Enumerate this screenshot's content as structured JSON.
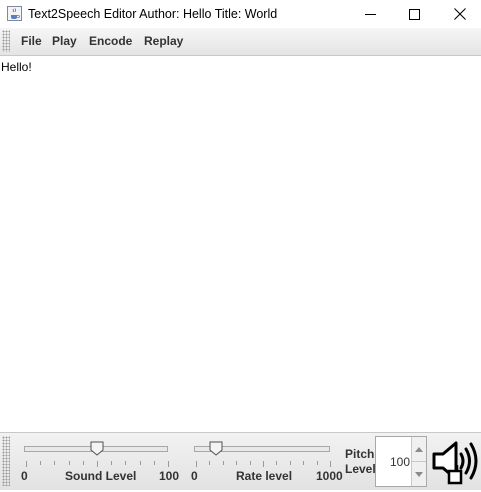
{
  "window": {
    "title": "Text2Speech Editor Author: Hello Title: World",
    "icon": "java-cup-icon"
  },
  "menu": {
    "items": [
      {
        "label": "File"
      },
      {
        "label": "Play"
      },
      {
        "label": "Encode"
      },
      {
        "label": "Replay"
      }
    ]
  },
  "editor": {
    "text": "Hello!"
  },
  "controls": {
    "sound": {
      "label": "Sound Level",
      "min_label": "0",
      "max_label": "100",
      "min": 0,
      "max": 100,
      "value": 50
    },
    "rate": {
      "label": "Rate level",
      "min_label": "0",
      "max_label": "1000",
      "min": 0,
      "max": 1000,
      "value": 150
    },
    "pitch": {
      "label_line1": "Pitch",
      "label_line2": "Level",
      "value": "100"
    },
    "speak_icon": "speaker-icon"
  }
}
